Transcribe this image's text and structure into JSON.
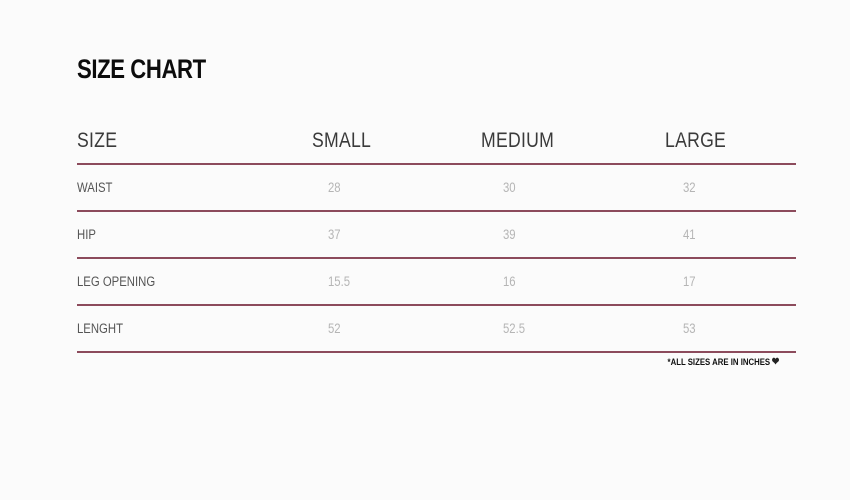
{
  "title": "SIZE CHART",
  "table": {
    "headers": [
      "SIZE",
      "SMALL",
      "MEDIUM",
      "LARGE"
    ],
    "rows": [
      {
        "label": "WAIST",
        "values": [
          "28",
          "30",
          "32"
        ]
      },
      {
        "label": "HIP",
        "values": [
          "37",
          "39",
          "41"
        ]
      },
      {
        "label": "LEG OPENING",
        "values": [
          "15.5",
          "16",
          "17"
        ]
      },
      {
        "label": "LENGHT",
        "values": [
          "52",
          "52.5",
          "53"
        ]
      }
    ]
  },
  "footnote": {
    "text": "*ALL SIZES ARE IN  INCHES",
    "icon": "heart-icon"
  },
  "colors": {
    "divider": "#8c4b5c",
    "title": "#0c0c0c",
    "value_text": "#b5b5b5"
  }
}
